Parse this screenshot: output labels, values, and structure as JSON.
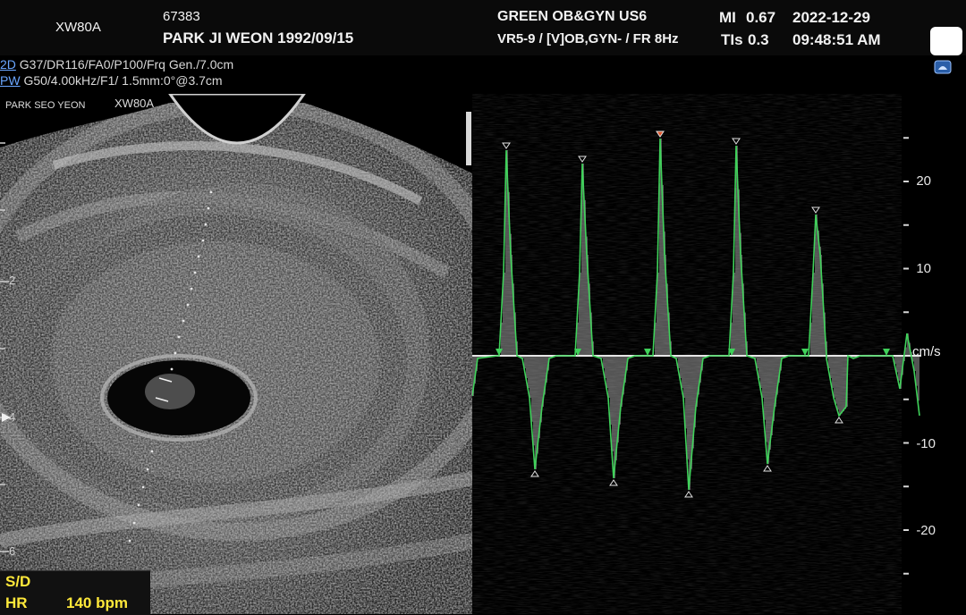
{
  "header": {
    "model": "XW80A",
    "patient_id": "67383",
    "patient_name": "PARK JI WEON 1992/09/15",
    "clinic": "GREEN OB&GYN US6",
    "preset": "VR5-9 / [V]OB,GYN- / FR 8Hz",
    "mi_label": "MI",
    "mi_value": "0.67",
    "tis_label": "TIs",
    "tis_value": "0.3",
    "date": "2022-12-29",
    "time": "09:48:51 AM"
  },
  "params": {
    "mode_2d": "2D",
    "line_2d": "G37/DR116/FA0/P100/Frq Gen./7.0cm",
    "mode_pw": "PW",
    "line_pw": "G50/4.00kHz/F1/ 1.5mm:0°@3.7cm"
  },
  "image_labels": {
    "operator": "PARK SEO YEON",
    "model_overlay": "XW80A"
  },
  "depth_marks": [
    "2",
    "4",
    "6"
  ],
  "doppler": {
    "unit": "cm/s",
    "axis_labels": [
      "20",
      "10",
      "-10",
      "-20"
    ],
    "axis_values": [
      20,
      10,
      -10,
      -20
    ]
  },
  "measurement": {
    "sd_label": "S/D",
    "hr_label": "HR",
    "hr_value": "140 bpm"
  },
  "colors": {
    "trace": "#3fd25a",
    "text_yellow": "#ffe83a",
    "mode_blue": "#6aa6ff",
    "marker_orange": "#e0552a"
  },
  "icons": [
    "doppler-probe-icon",
    "gallery-icon"
  ]
}
